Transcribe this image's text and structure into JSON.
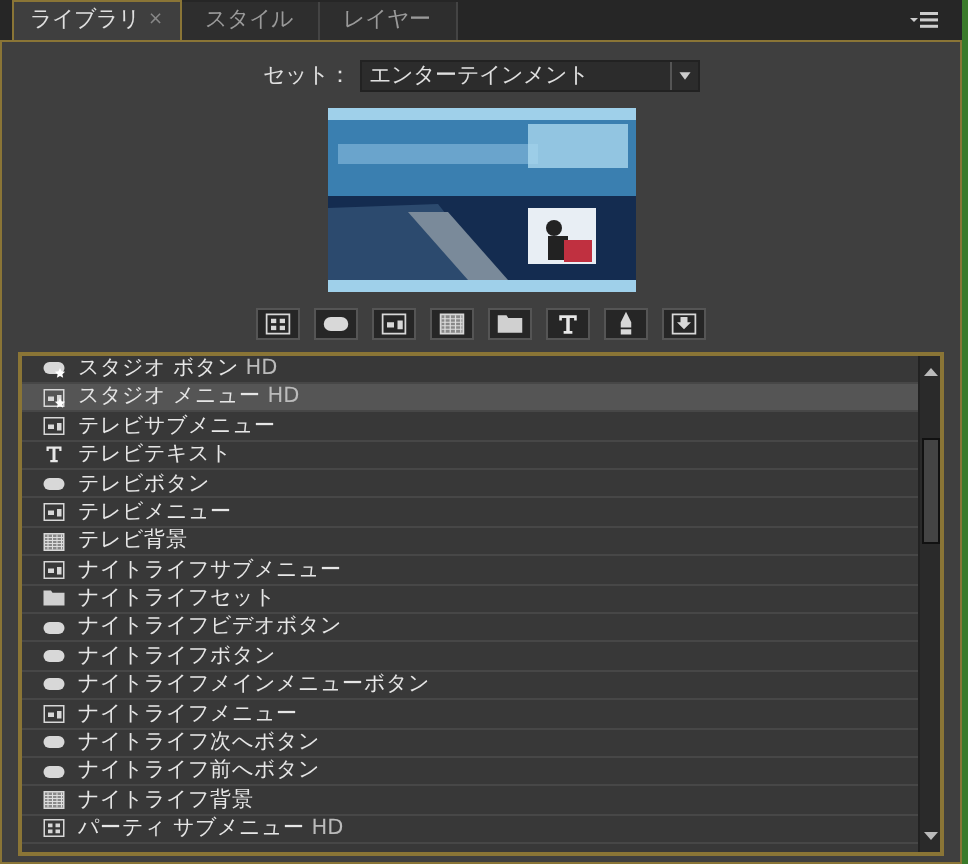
{
  "tabs": [
    {
      "label": "ライブラリ",
      "selected": true,
      "close": "×"
    },
    {
      "label": "スタイル",
      "selected": false
    },
    {
      "label": "レイヤー",
      "selected": false
    }
  ],
  "set": {
    "label": "セット：",
    "value": "エンターテインメント"
  },
  "toolbar": [
    {
      "kind": "grid"
    },
    {
      "kind": "button"
    },
    {
      "kind": "menu"
    },
    {
      "kind": "background"
    },
    {
      "kind": "folder"
    },
    {
      "kind": "text"
    },
    {
      "kind": "pen"
    },
    {
      "kind": "import"
    }
  ],
  "items": [
    {
      "kind": "button",
      "starred": true,
      "name": "スタジオ ボタン",
      "tag": "HD",
      "selected": false
    },
    {
      "kind": "menu",
      "starred": true,
      "name": "スタジオ メニュー",
      "tag": "HD",
      "selected": true
    },
    {
      "kind": "menu",
      "starred": false,
      "name": "テレビサブメニュー",
      "selected": false
    },
    {
      "kind": "text",
      "starred": false,
      "name": "テレビテキスト",
      "selected": false
    },
    {
      "kind": "button",
      "starred": false,
      "name": "テレビボタン",
      "selected": false
    },
    {
      "kind": "menu",
      "starred": false,
      "name": "テレビメニュー",
      "selected": false
    },
    {
      "kind": "background",
      "starred": false,
      "name": "テレビ背景",
      "selected": false
    },
    {
      "kind": "menu",
      "starred": false,
      "name": "ナイトライフサブメニュー",
      "selected": false
    },
    {
      "kind": "folder",
      "starred": false,
      "name": "ナイトライフセット",
      "selected": false
    },
    {
      "kind": "button",
      "starred": false,
      "name": "ナイトライフビデオボタン",
      "selected": false
    },
    {
      "kind": "button",
      "starred": false,
      "name": "ナイトライフボタン",
      "selected": false
    },
    {
      "kind": "button",
      "starred": false,
      "name": "ナイトライフメインメニューボタン",
      "selected": false
    },
    {
      "kind": "menu",
      "starred": false,
      "name": "ナイトライフメニュー",
      "selected": false
    },
    {
      "kind": "button",
      "starred": false,
      "name": "ナイトライフ次へボタン",
      "selected": false
    },
    {
      "kind": "button",
      "starred": false,
      "name": "ナイトライフ前へボタン",
      "selected": false
    },
    {
      "kind": "background",
      "starred": false,
      "name": "ナイトライフ背景",
      "selected": false
    },
    {
      "kind": "grid",
      "starred": false,
      "name": "パーティ サブメニュー",
      "tag": "HD",
      "selected": false
    }
  ]
}
